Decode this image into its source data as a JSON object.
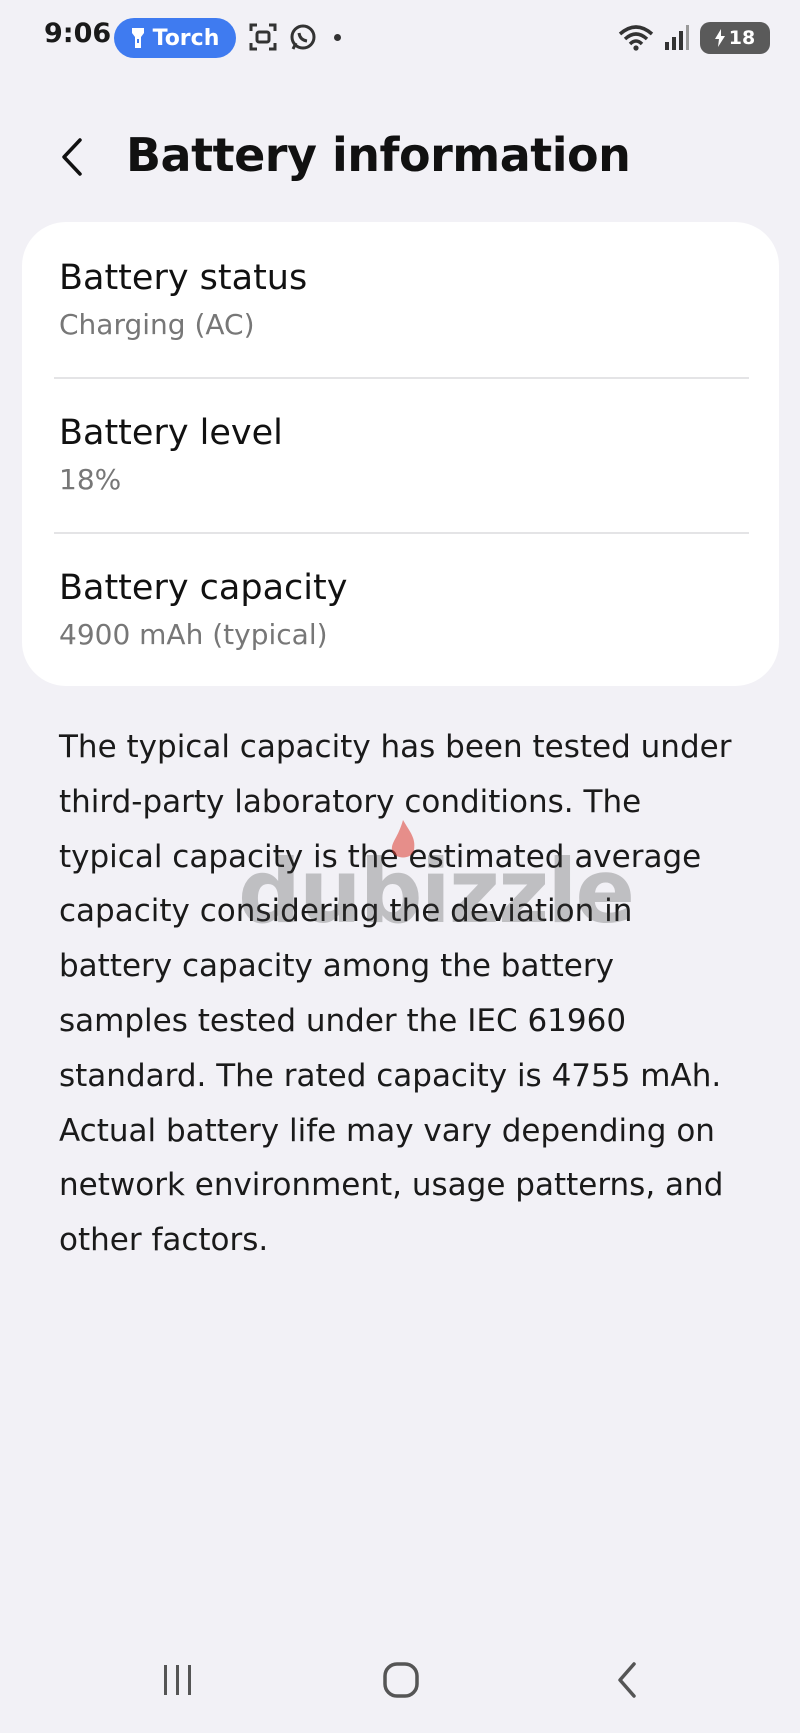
{
  "status_bar": {
    "time": "9:06",
    "torch_label": "Torch",
    "battery_percent": "18",
    "icons": [
      "torch-icon",
      "screenshot-icon",
      "whatsapp-icon",
      "notification-dot",
      "wifi-icon",
      "signal-icon",
      "battery-charging-icon"
    ]
  },
  "header": {
    "title": "Battery information",
    "back_icon": "chevron-left-icon"
  },
  "card": {
    "items": [
      {
        "title": "Battery status",
        "value": "Charging (AC)"
      },
      {
        "title": "Battery level",
        "value": "18%"
      },
      {
        "title": "Battery capacity",
        "value": "4900 mAh (typical)"
      }
    ]
  },
  "description": "The typical capacity has been tested under third-party laboratory conditions. The typical capacity is the estimated average capacity considering the deviation in battery capacity among the battery samples tested under the IEC 61960 standard. The rated capacity is 4755 mAh. Actual battery life may vary depending on network environment, usage patterns, and other factors.",
  "watermark": "dubizzle",
  "navbar": {
    "icons": [
      "recents-icon",
      "home-icon",
      "back-icon"
    ]
  },
  "colors": {
    "background": "#f2f1f6",
    "card": "#ffffff",
    "torch_pill": "#3f7bf0",
    "secondary_text": "#777777"
  }
}
